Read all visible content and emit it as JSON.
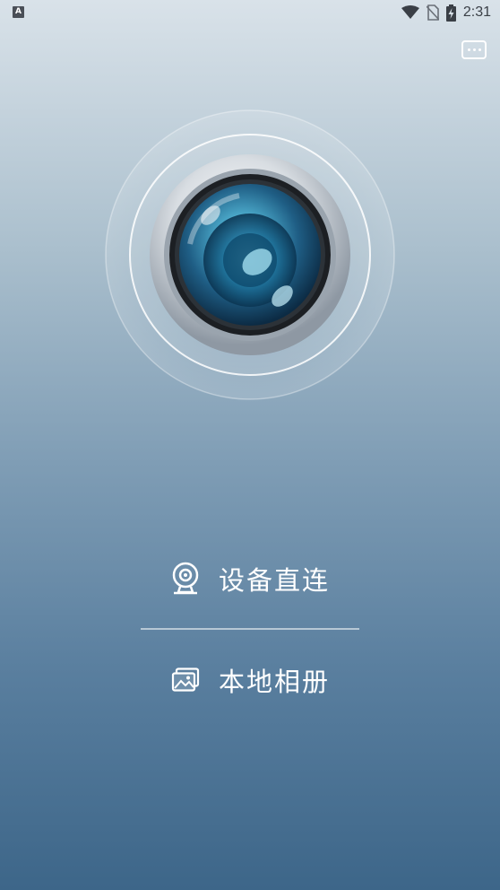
{
  "status_bar": {
    "notification_icon": "A",
    "time": "2:31",
    "icons": [
      "wifi-icon",
      "no-sim-icon",
      "battery-charging-icon"
    ]
  },
  "header": {
    "menu_icon": "more-dots-icon"
  },
  "hero": {
    "image": "camera-lens-icon"
  },
  "menu": {
    "items": [
      {
        "icon": "webcam-icon",
        "label": "设备直连"
      },
      {
        "icon": "album-icon",
        "label": "本地相册"
      }
    ]
  }
}
